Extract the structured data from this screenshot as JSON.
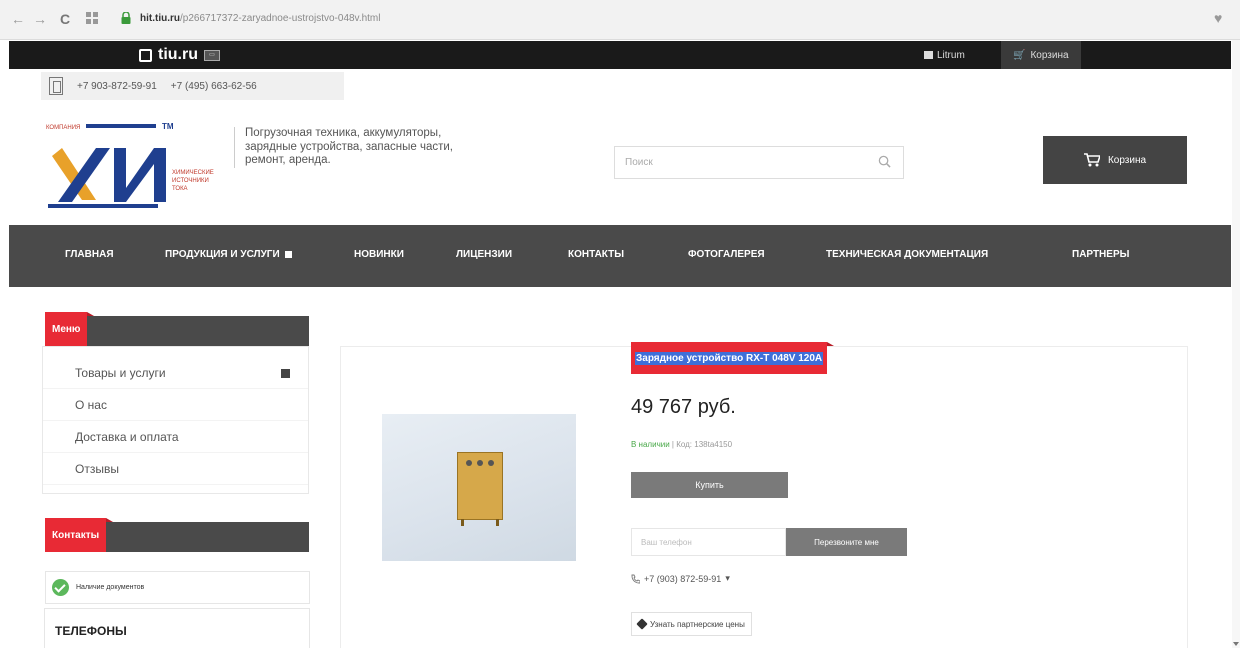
{
  "browser": {
    "url_host": "hit.tiu.ru",
    "url_path": "/p266717372-zaryadnoe-ustrojstvo-048v.html",
    "back": "←",
    "forward": "→",
    "reload": "C",
    "heart": "♥"
  },
  "tiubar": {
    "logo": "tiu.ru",
    "chat_label": "Litrum",
    "cart_label": "Корзина"
  },
  "phones": [
    "+7 903-872-59-91",
    "+7 (495) 663-62-56"
  ],
  "header": {
    "company_top": "КОМПАНИЯ",
    "company_tm": "TM",
    "company_lines": [
      "ХИМИЧЕСКИЕ",
      "ИСТОЧНИКИ",
      "ТОКА"
    ],
    "tagline": "Погрузочная техника, аккумуляторы, зарядные устройства, запасные части, ремонт, аренда.",
    "search_placeholder": "Поиск",
    "cart_label": "Корзина"
  },
  "nav": [
    "Главная",
    "Продукция и услуги",
    "Новинки",
    "Лицензии",
    "Контакты",
    "Фотогалерея",
    "Техническая документация",
    "Партнеры"
  ],
  "sidebar": {
    "menu_title": "Меню",
    "menu_items": [
      "Товары и услуги",
      "О нас",
      "Доставка и оплата",
      "Отзывы"
    ],
    "contacts_title": "Контакты",
    "docs_label": "Наличие документов",
    "phones_title": "ТЕЛЕФОНЫ"
  },
  "product": {
    "title": "Зарядное устройство RX-T 048V 120A",
    "price": "49 767 руб.",
    "in_stock": "В наличии",
    "code": "Код: 138ta4150",
    "buy_label": "Купить",
    "phone_placeholder": "Ваш телефон",
    "callback_label": "Перезвоните мне",
    "contact_phone": "+7 (903) 872-59-91",
    "partner_label": "Узнать партнерские цены"
  }
}
